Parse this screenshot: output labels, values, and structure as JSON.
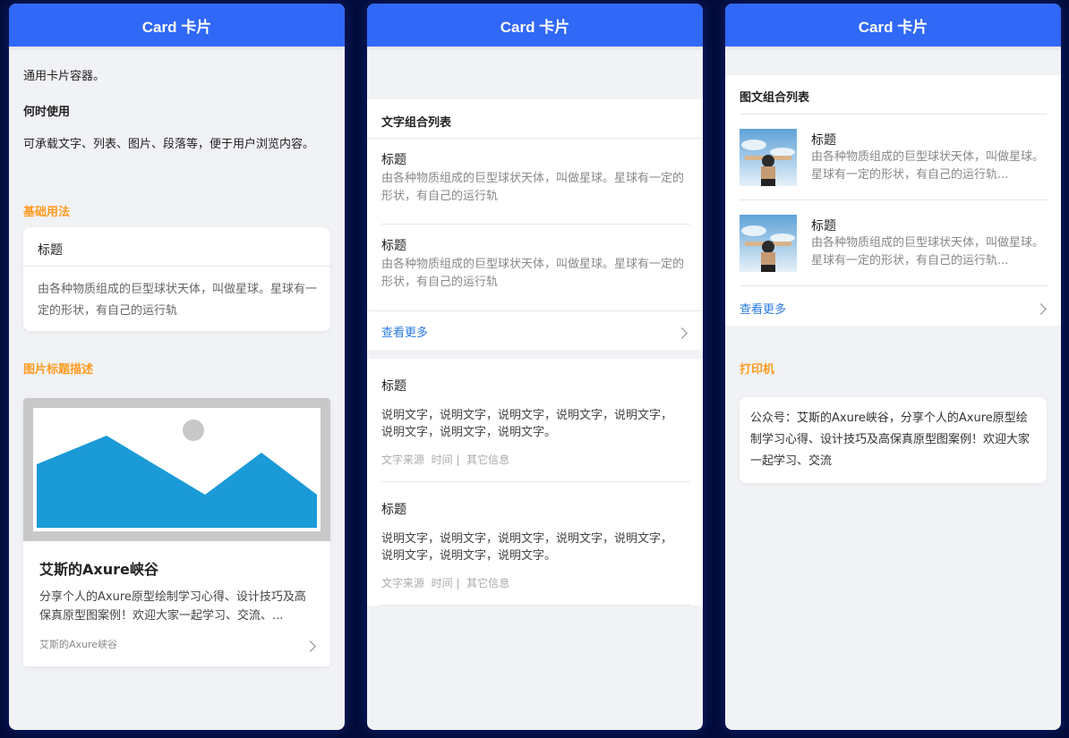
{
  "panel1": {
    "header": "Card 卡片",
    "intro": "通用卡片容器。",
    "when_title": "何时使用",
    "when_desc": "可承载文字、列表、图片、段落等，便于用户浏览内容。",
    "basic_label": "基础用法",
    "basic_card": {
      "title": "标题",
      "body": "由各种物质组成的巨型球状天体，叫做星球。星球有一定的形状，有自己的运行轨"
    },
    "image_label": "图片标题描述",
    "image_card": {
      "title": "艾斯的Axure峡谷",
      "desc": "分享个人的Axure原型绘制学习心得、设计技巧及高保真原型图案例！欢迎大家一起学习、交流、...",
      "footer": "艾斯的Axure峡谷"
    }
  },
  "panel2": {
    "header": "Card 卡片",
    "list_title": "文字组合列表",
    "list_items": [
      {
        "title": "标题",
        "desc": "由各种物质组成的巨型球状天体，叫做星球。星球有一定的形状，有自己的运行轨"
      },
      {
        "title": "标题",
        "desc": "由各种物质组成的巨型球状天体，叫做星球。星球有一定的形状，有自己的运行轨"
      }
    ],
    "more": "查看更多",
    "articles": [
      {
        "title": "标题",
        "desc": "说明文字，说明文字，说明文字，说明文字，说明文字，说明文字，说明文字，说明文字。",
        "source": "文字来源",
        "time": "时间",
        "other": "其它信息"
      },
      {
        "title": "标题",
        "desc": "说明文字，说明文字，说明文字，说明文字，说明文字，说明文字，说明文字，说明文字。",
        "source": "文字来源",
        "time": "时间",
        "other": "其它信息"
      }
    ]
  },
  "panel3": {
    "header": "Card 卡片",
    "list_title": "图文组合列表",
    "items": [
      {
        "title": "标题",
        "desc": "由各种物质组成的巨型球状天体，叫做星球。星球有一定的形状，有自己的运行轨..."
      },
      {
        "title": "标题",
        "desc": "由各种物质组成的巨型球状天体，叫做星球。星球有一定的形状，有自己的运行轨..."
      }
    ],
    "more": "查看更多",
    "print_label": "打印机",
    "print_text": "公众号：艾斯的Axure峡谷，分享个人的Axure原型绘制学习心得、设计技巧及高保真原型图案例！欢迎大家一起学习、交流"
  },
  "colors": {
    "header": "#3068f7",
    "accent_orange": "#ff9a1f",
    "link": "#2a7ae2",
    "background": "#020b3a"
  }
}
